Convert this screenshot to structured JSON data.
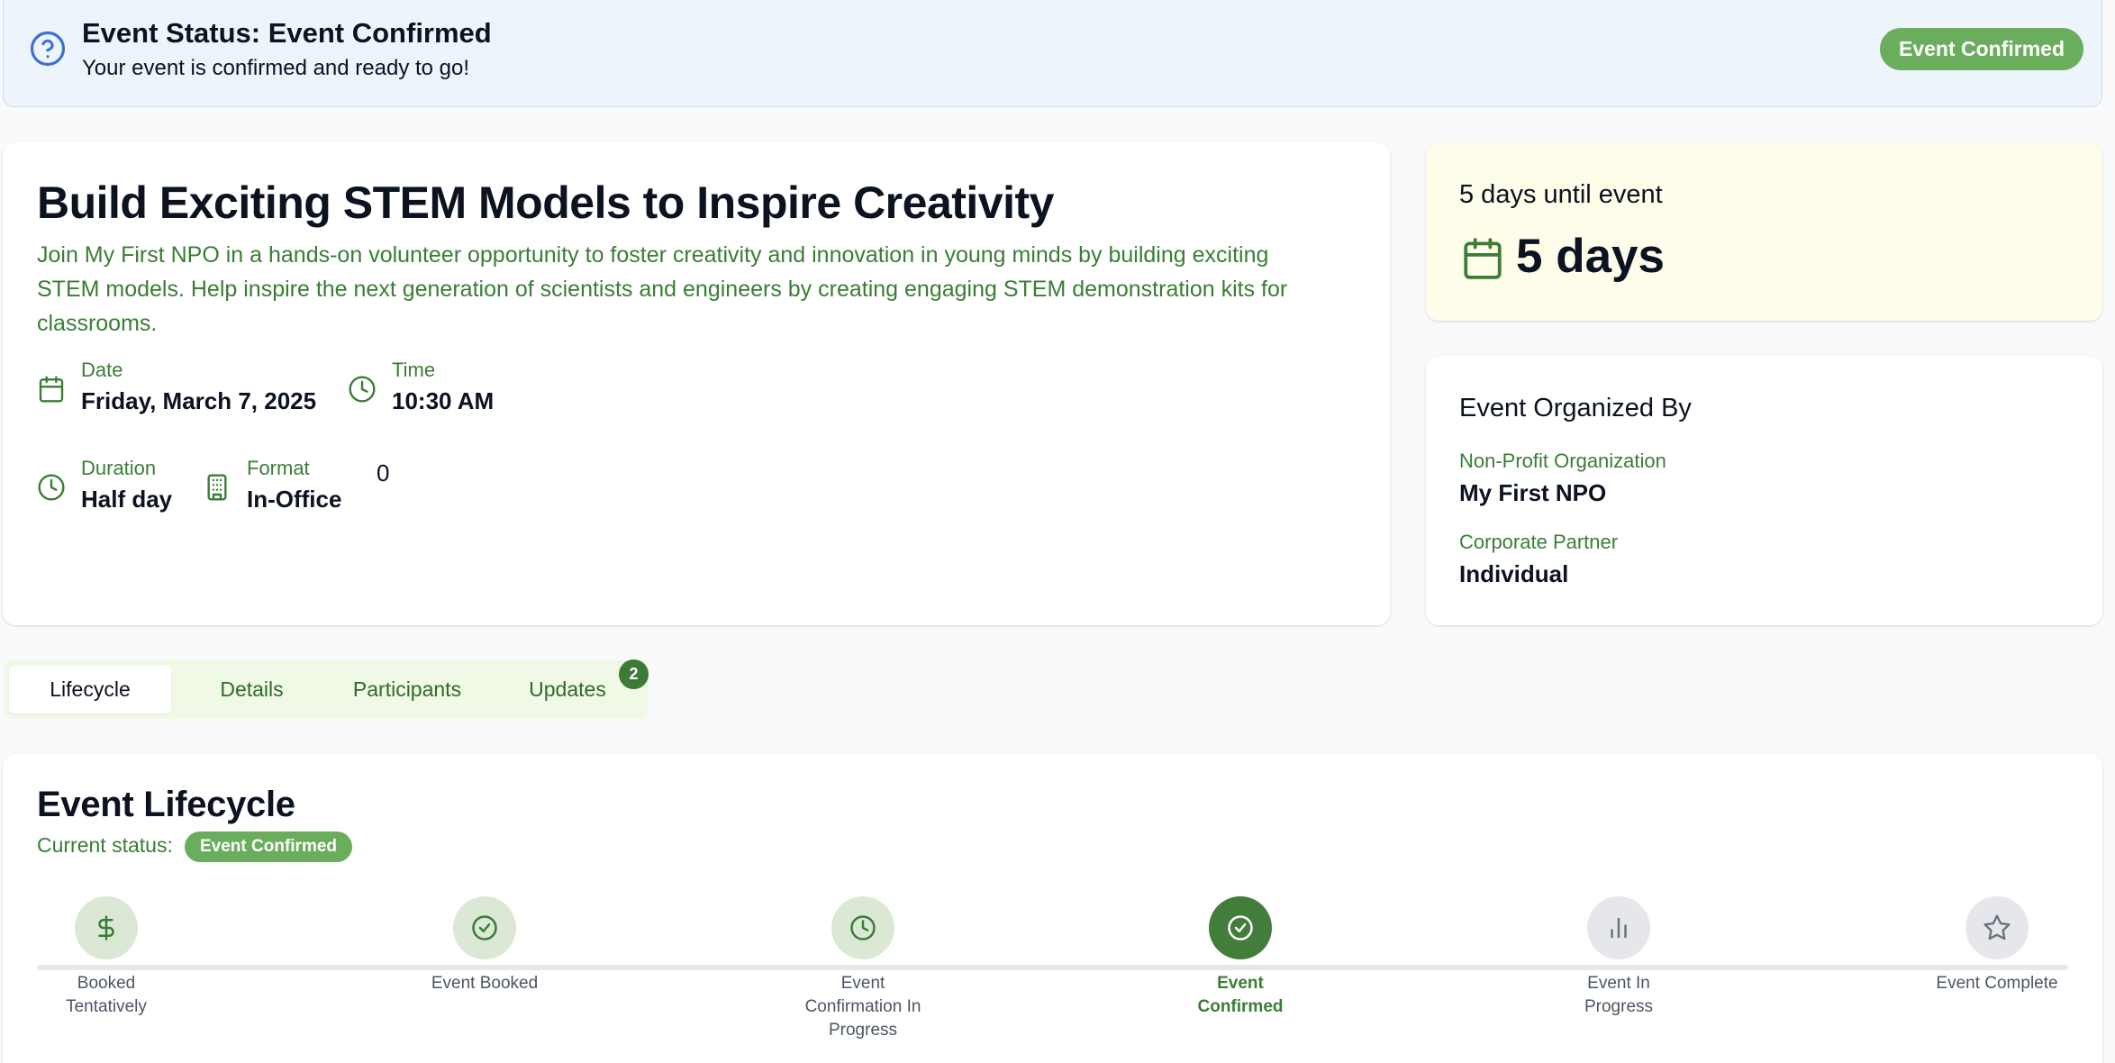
{
  "banner": {
    "title": "Event Status: Event Confirmed",
    "subtitle": "Your event is confirmed and ready to go!",
    "badge": "Event Confirmed",
    "icon": "help-circle-icon"
  },
  "event": {
    "title": "Build Exciting STEM Models to Inspire Creativity",
    "description": "Join My First NPO in a hands-on volunteer opportunity to foster creativity and innovation in young minds by building exciting STEM models. Help inspire the next generation of scientists and engineers by creating engaging STEM demonstration kits for classrooms.",
    "date": {
      "label": "Date",
      "value": "Friday, March 7, 2025",
      "icon": "calendar-icon"
    },
    "time": {
      "label": "Time",
      "value": "10:30 AM",
      "icon": "clock-icon"
    },
    "duration": {
      "label": "Duration",
      "value": "Half day",
      "icon": "clock-icon"
    },
    "format": {
      "label": "Format",
      "value": "In-Office",
      "icon": "building-icon"
    },
    "extra_value": "0"
  },
  "countdown": {
    "label": "5 days until event",
    "value": "5 days",
    "icon": "calendar-icon"
  },
  "organizer": {
    "title": "Event Organized By",
    "npo_label": "Non-Profit Organization",
    "npo_value": "My First NPO",
    "partner_label": "Corporate Partner",
    "partner_value": "Individual"
  },
  "tabs": [
    {
      "label": "Lifecycle",
      "active": true
    },
    {
      "label": "Details",
      "active": false
    },
    {
      "label": "Participants",
      "active": false
    },
    {
      "label": "Updates",
      "active": false,
      "badge": "2"
    }
  ],
  "lifecycle": {
    "title": "Event Lifecycle",
    "status_label": "Current status:",
    "status_badge": "Event Confirmed",
    "steps": [
      {
        "label": "Booked Tentatively",
        "state": "done",
        "icon": "dollar-icon"
      },
      {
        "label": "Event Booked",
        "state": "done",
        "icon": "check-circle-icon"
      },
      {
        "label": "Event Confirmation In Progress",
        "state": "done",
        "icon": "clock-icon"
      },
      {
        "label": "Event Confirmed",
        "state": "current",
        "icon": "check-circle-icon"
      },
      {
        "label": "Event In Progress",
        "state": "todo",
        "icon": "bar-chart-icon"
      },
      {
        "label": "Event Complete",
        "state": "todo",
        "icon": "star-icon"
      }
    ]
  },
  "colors": {
    "accent_green": "#3a7d35",
    "badge_green": "#6aae5d",
    "current_step": "#427d3c",
    "banner_bg": "#eef4fb",
    "countdown_bg": "#fdfde9"
  }
}
